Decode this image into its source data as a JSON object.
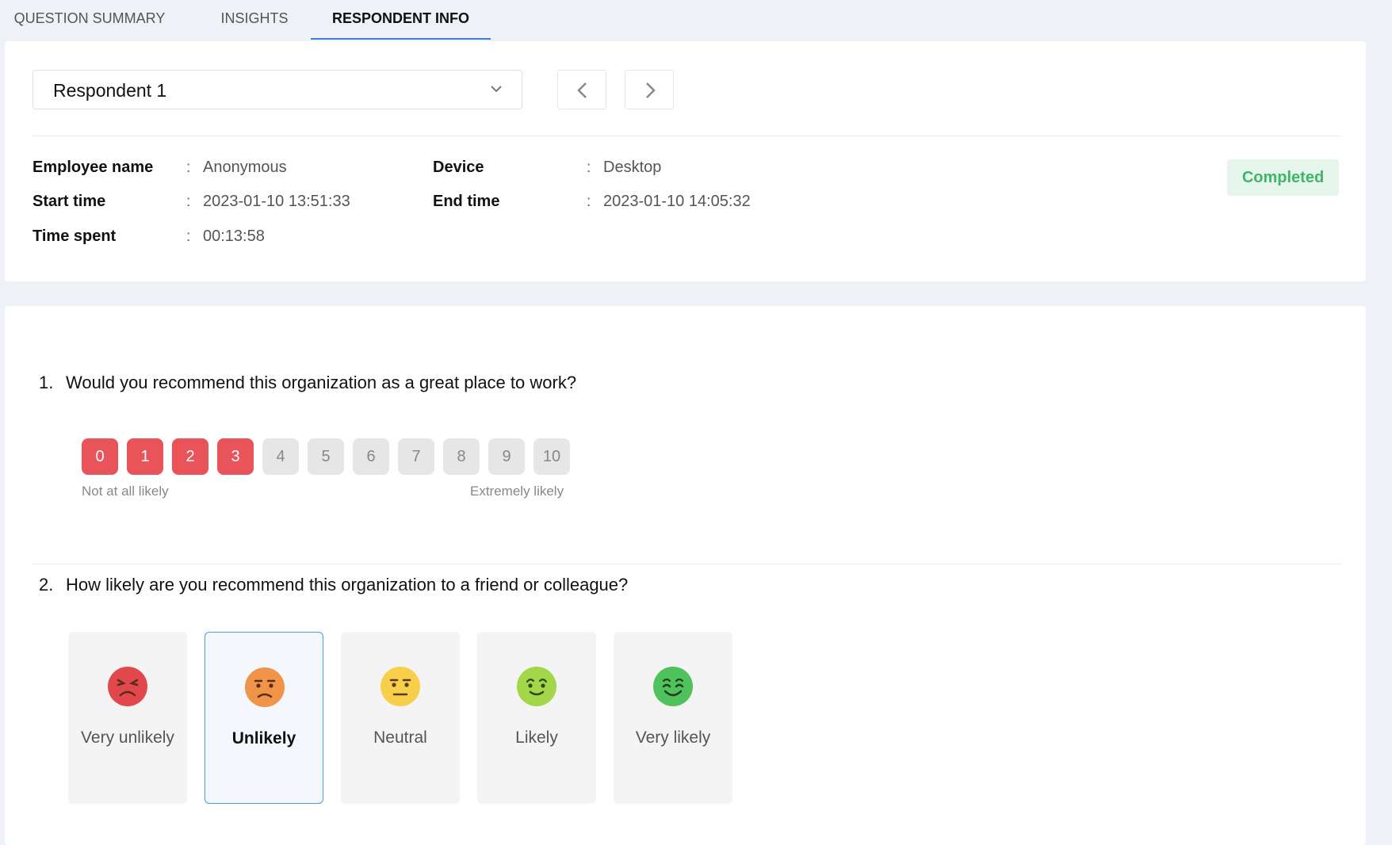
{
  "tabs": [
    {
      "label": "QUESTION SUMMARY",
      "active": false
    },
    {
      "label": "INSIGHTS",
      "active": false
    },
    {
      "label": "RESPONDENT INFO",
      "active": true
    }
  ],
  "respondent": {
    "selected": "Respondent 1",
    "prev_icon": "chevron-left-icon",
    "next_icon": "chevron-right-icon"
  },
  "info": {
    "employee_name": {
      "label": "Employee name",
      "value": "Anonymous"
    },
    "start_time": {
      "label": "Start time",
      "value": "2023-01-10 13:51:33"
    },
    "time_spent": {
      "label": "Time spent",
      "value": "00:13:58"
    },
    "device": {
      "label": "Device",
      "value": "Desktop"
    },
    "end_time": {
      "label": "End time",
      "value": "2023-01-10 14:05:32"
    },
    "separator": ":",
    "status": "Completed"
  },
  "questions": [
    {
      "number": "1.",
      "text": "Would you recommend this organization as a great place to work?",
      "type": "nps",
      "scale": [
        "0",
        "1",
        "2",
        "3",
        "4",
        "5",
        "6",
        "7",
        "8",
        "9",
        "10"
      ],
      "selected_value": 3,
      "low_label": "Not at all likely",
      "high_label": "Extremely likely"
    },
    {
      "number": "2.",
      "text": "How likely are you recommend this organization to a friend or colleague?",
      "type": "emoji",
      "options": [
        {
          "label": "Very unlikely",
          "icon": "angry-face-icon",
          "color": "#e0484e"
        },
        {
          "label": "Unlikely",
          "icon": "frowning-face-icon",
          "color": "#f0944a"
        },
        {
          "label": "Neutral",
          "icon": "neutral-face-icon",
          "color": "#f7cf4a"
        },
        {
          "label": "Likely",
          "icon": "smiling-face-icon",
          "color": "#a4d64a"
        },
        {
          "label": "Very likely",
          "icon": "happy-face-icon",
          "color": "#4fc25e"
        }
      ],
      "selected": "Unlikely"
    }
  ],
  "colors": {
    "accent": "#3b7dd8",
    "selected_score": "#e9545a",
    "status": "#3fb56a"
  }
}
